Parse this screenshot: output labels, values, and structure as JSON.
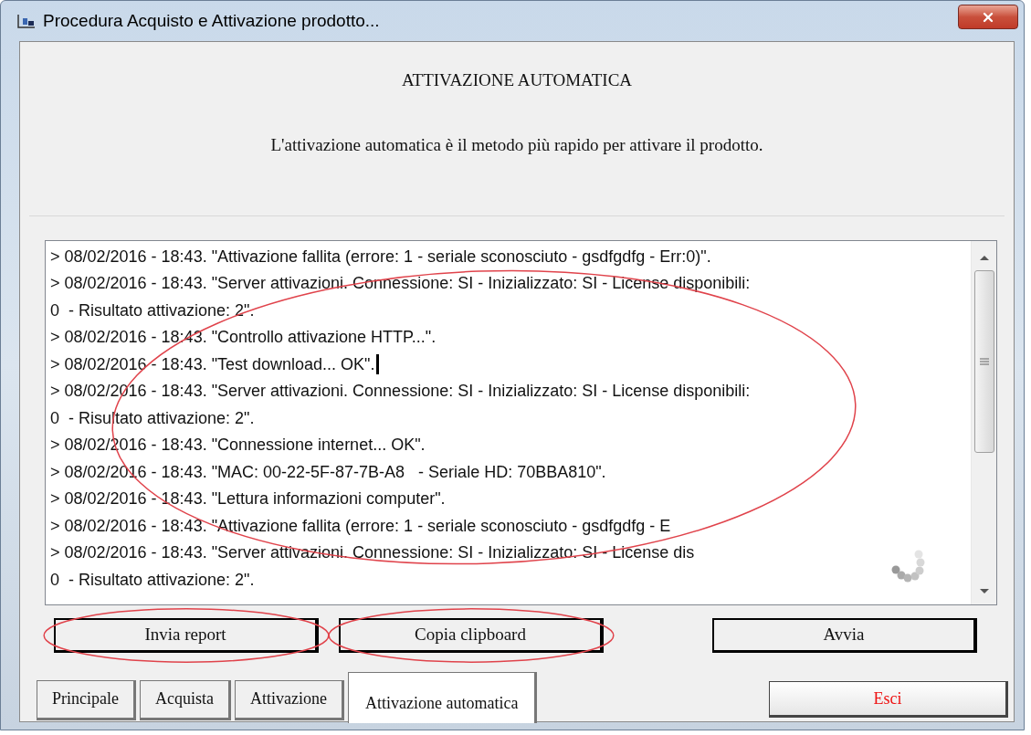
{
  "window": {
    "title": "Procedura Acquisto e Attivazione prodotto..."
  },
  "header": {
    "title": "ATTIVAZIONE AUTOMATICA",
    "description": "L'attivazione automatica è il metodo più rapido per attivare il prodotto."
  },
  "log": {
    "circled": true,
    "busy": true,
    "lines": [
      {
        "text": "> 08/02/2016 - 18:43. \"Attivazione fallita (errore: 1 - seriale sconosciuto - gsdfgdfg - Err:0)\".",
        "cursor": false
      },
      {
        "text": "> 08/02/2016 - 18:43. \"Server attivazioni. Connessione: SI - Inizializzato: SI - License disponibili:",
        "cursor": false
      },
      {
        "text": "0  - Risultato attivazione: 2\".",
        "cursor": false
      },
      {
        "text": "> 08/02/2016 - 18:43. \"Controllo attivazione HTTP...\".",
        "cursor": false
      },
      {
        "text": "> 08/02/2016 - 18:43. \"Test download... OK\".",
        "cursor": true
      },
      {
        "text": "> 08/02/2016 - 18:43. \"Server attivazioni. Connessione: SI - Inizializzato: SI - License disponibili:",
        "cursor": false
      },
      {
        "text": "0  - Risultato attivazione: 2\".",
        "cursor": false
      },
      {
        "text": "> 08/02/2016 - 18:43. \"Connessione internet... OK\".",
        "cursor": false
      },
      {
        "text": "> 08/02/2016 - 18:43. \"MAC: 00-22-5F-87-7B-A8   - Seriale HD: 70BBA810\".",
        "cursor": false
      },
      {
        "text": "> 08/02/2016 - 18:43. \"Lettura informazioni computer\".",
        "cursor": false
      },
      {
        "text": "> 08/02/2016 - 18:43. \"Attivazione fallita (errore: 1 - seriale sconosciuto - gsdfgdfg - E",
        "cursor": false
      },
      {
        "text": "> 08/02/2016 - 18:43. \"Server attivazioni. Connessione: SI - Inizializzato: SI - License dis",
        "cursor": false
      },
      {
        "text": "0  - Risultato attivazione: 2\".",
        "cursor": false
      }
    ]
  },
  "buttons": [
    {
      "label": "Invia report",
      "circled": true
    },
    {
      "label": "Copia clipboard",
      "circled": true
    },
    {
      "label": "Avvia",
      "circled": false
    }
  ],
  "tabs": [
    {
      "label": "Principale",
      "selected": false
    },
    {
      "label": "Acquista",
      "selected": false
    },
    {
      "label": "Attivazione",
      "selected": false
    },
    {
      "label": "Attivazione automatica",
      "selected": true
    }
  ],
  "exit_button": {
    "label": "Esci"
  }
}
